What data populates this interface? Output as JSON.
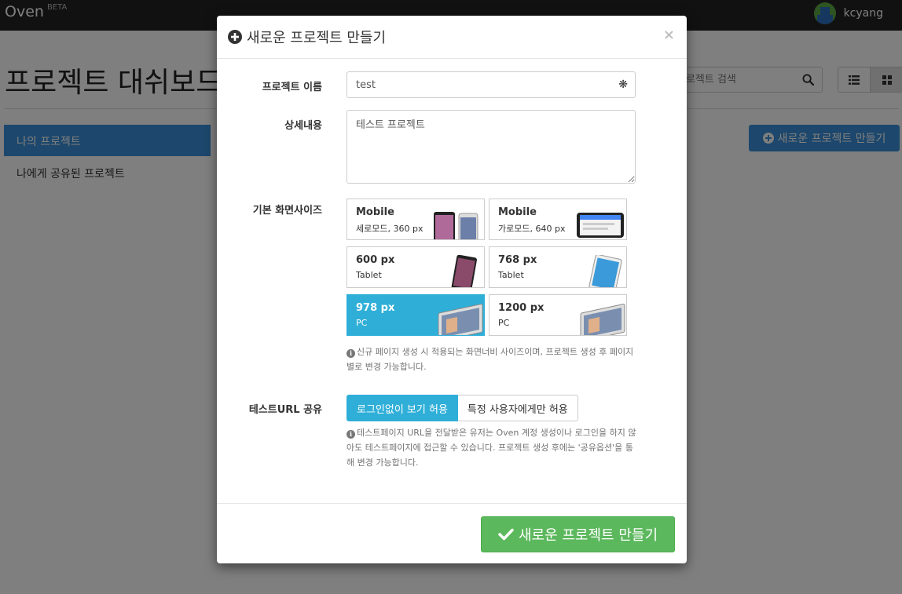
{
  "navbar": {
    "brand": "Oven",
    "beta": "BETA",
    "username": "kcyang"
  },
  "page": {
    "title": "프로젝트 대쉬보드"
  },
  "search": {
    "placeholder": "프로젝트 검색"
  },
  "sidebar": {
    "items": [
      {
        "label": "나의 프로젝트",
        "active": true
      },
      {
        "label": "나에게 공유된 프로젝트",
        "active": false
      }
    ]
  },
  "background": {
    "new_project_label": "새로운 프로젝트 만들기"
  },
  "modal": {
    "title": "새로운 프로젝트 만들기",
    "close": "×",
    "name_label": "프로젝트 이름",
    "name_value": "test",
    "required_mark": "❋",
    "desc_label": "상세내용",
    "desc_value": "테스트 프로젝트",
    "size_label": "기본 화면사이즈",
    "sizes": [
      {
        "title": "Mobile",
        "subtitle": "세로모드, 360 px",
        "active": false
      },
      {
        "title": "Mobile",
        "subtitle": "가로모드, 640 px",
        "active": false
      },
      {
        "title": "600 px",
        "subtitle": "Tablet",
        "active": false
      },
      {
        "title": "768 px",
        "subtitle": "Tablet",
        "active": false
      },
      {
        "title": "978 px",
        "subtitle": "PC",
        "active": true
      },
      {
        "title": "1200 px",
        "subtitle": "PC",
        "active": false
      }
    ],
    "size_help": "신규 페이지 생성 시 적용되는 화면너비 사이즈이며, 프로젝트 생성 후 페이지 별로 변경 가능합니다.",
    "share_label": "테스트URL 공유",
    "share_options": [
      {
        "label": "로그인없이 보기 허용",
        "active": true
      },
      {
        "label": "특정 사용자에게만 허용",
        "active": false
      }
    ],
    "share_help": "테스트페이지 URL을 전달받은 유저는 Oven 계정 생성이나 로그인을 하지 않아도 테스트페이지에 접근할 수 있습니다. 프로젝트 생성 후에는 '공유옵션'을 통해 변경 가능합니다.",
    "submit_label": "새로운 프로젝트 만들기"
  },
  "colors": {
    "primary": "#3a8fd8",
    "active_card": "#2fafd8",
    "success": "#5cb85c",
    "navbar": "#222222"
  }
}
